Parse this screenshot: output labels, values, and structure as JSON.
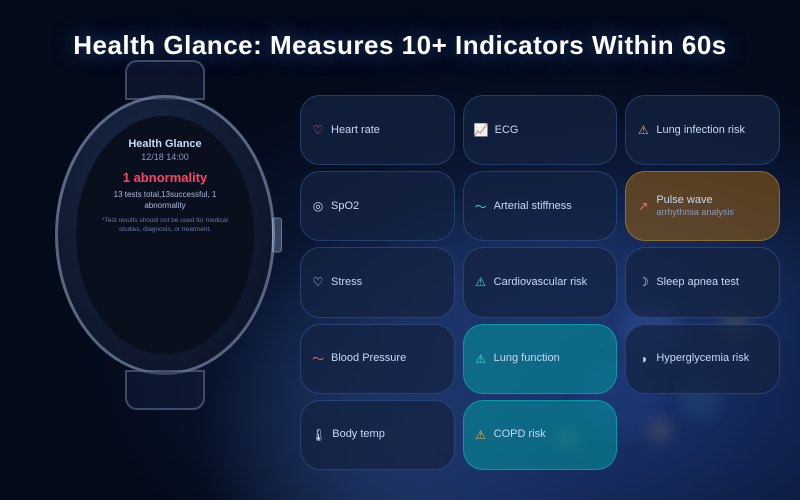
{
  "title": "Health Glance: Measures 10+ Indicators Within 60s",
  "watch": {
    "name": "Health Glance",
    "date": "12/18 14:00",
    "alert": "1 abnormality",
    "subtitle": "13 tests total,13successful, 1\nabnormality",
    "note": "*Test results should not be\nused for medical studies,\ndiagnosis, or treatment."
  },
  "indicators": [
    {
      "id": "heart-rate",
      "icon": "♡",
      "iconClass": "red",
      "label": "Heart rate",
      "highlight": ""
    },
    {
      "id": "ecg",
      "icon": "📈",
      "iconClass": "white",
      "label": "ECG",
      "highlight": ""
    },
    {
      "id": "lung-infection",
      "icon": "⚠",
      "iconClass": "orange",
      "label": "Lung infection risk",
      "highlight": ""
    },
    {
      "id": "spo2",
      "icon": "◎",
      "iconClass": "white",
      "label": "SpO2",
      "highlight": ""
    },
    {
      "id": "arterial-stiffness",
      "icon": "〜",
      "iconClass": "cyan",
      "label": "Arterial stiffness",
      "highlight": ""
    },
    {
      "id": "pulse-wave",
      "icon": "↗",
      "iconClass": "red",
      "label": "Pulse wave",
      "label2": "arrhythmia analysis",
      "highlight": "gold"
    },
    {
      "id": "stress",
      "icon": "♡",
      "iconClass": "white",
      "label": "Stress",
      "highlight": ""
    },
    {
      "id": "cardiovascular",
      "icon": "⚠",
      "iconClass": "cyan",
      "label": "Cardiovascular risk",
      "highlight": ""
    },
    {
      "id": "sleep-apnea",
      "icon": "☽",
      "iconClass": "white",
      "label": "Sleep apnea test",
      "highlight": ""
    },
    {
      "id": "blood-pressure",
      "icon": "〜",
      "iconClass": "red",
      "label": "Blood Pressure",
      "highlight": ""
    },
    {
      "id": "lung-function",
      "icon": "⚠",
      "iconClass": "cyan",
      "label": "Lung function",
      "highlight": "cyan"
    },
    {
      "id": "hyperglycemia",
      "icon": "◑",
      "iconClass": "white",
      "label": "Hyperglycemia risk",
      "highlight": ""
    },
    {
      "id": "body-temp",
      "icon": "🌡",
      "iconClass": "white",
      "label": "Body temp",
      "highlight": ""
    },
    {
      "id": "copd",
      "icon": "⚠",
      "iconClass": "orange",
      "label": "COPD risk",
      "highlight": "cyan"
    },
    {
      "id": "empty",
      "icon": "",
      "iconClass": "",
      "label": "",
      "highlight": "none"
    }
  ]
}
